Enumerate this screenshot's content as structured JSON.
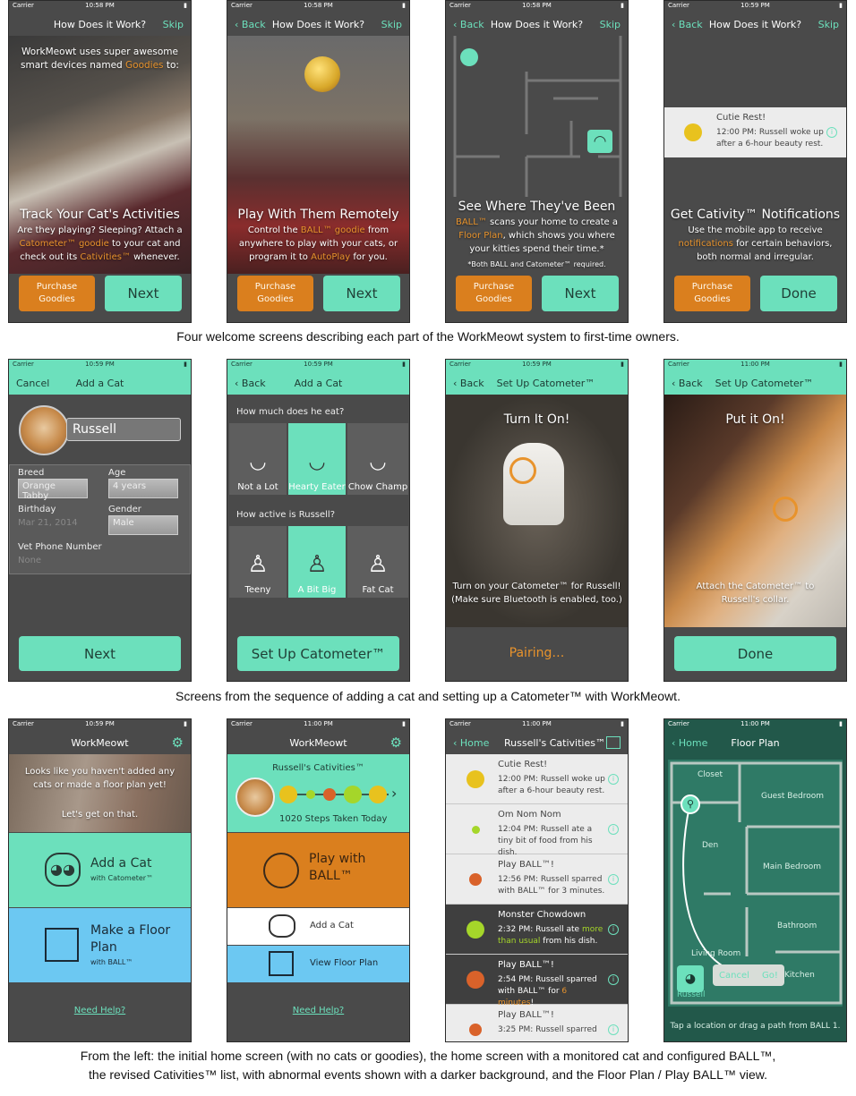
{
  "common": {
    "carrier": "Carrier",
    "skip": "Skip",
    "back": "Back",
    "next": "Next",
    "done": "Done",
    "cancel": "Cancel",
    "purchase_goodies": "Purchase Goodies"
  },
  "row1": {
    "screens": [
      {
        "time": "10:58 PM",
        "title": "How Does it Work?",
        "intro_a": "WorkMeowt uses super awesome smart devices named ",
        "intro_b": "Goodies",
        "intro_c": " to:",
        "heading": "Track Your Cat's Activities",
        "body_a": "Are they playing? Sleeping? Attach a ",
        "body_b": "Catometer™ goodie",
        "body_c": " to your cat and check out its ",
        "body_d": "Cativities™",
        "body_e": " whenever."
      },
      {
        "time": "10:58 PM",
        "title": "How Does it Work?",
        "heading": "Play With Them Remotely",
        "body_a": "Control the ",
        "body_b": "BALL™ goodie",
        "body_c": " from anywhere to play with your cats, or program it to ",
        "body_d": "AutoPlay",
        "body_e": " for you."
      },
      {
        "time": "10:58 PM",
        "title": "How Does it Work?",
        "heading": "See Where They've Been",
        "body_a": "BALL™",
        "body_b": " scans your home to create a ",
        "body_c": "Floor Plan",
        "body_d": ", which shows you where your kitties spend their time.*",
        "note": "*Both BALL and Catometer™ required."
      },
      {
        "time": "10:59 PM",
        "title": "How Does it Work?",
        "notif_title": "Cutie Rest!",
        "notif_body": "12:00 PM: Russell woke up after a 6-hour beauty rest.",
        "heading": "Get Cativity™ Notifications",
        "body_a": "Use the mobile app to receive ",
        "body_b": "notifications",
        "body_c": " for certain behaviors, both normal and irregular."
      }
    ],
    "caption": "Four welcome screens describing each part of the WorkMeowt system to first-time owners."
  },
  "row2": {
    "add_cat": {
      "time": "10:59 PM",
      "title": "Add a Cat",
      "name": "Russell",
      "breed_label": "Breed",
      "breed": "Orange Tabby",
      "age_label": "Age",
      "age": "4 years",
      "birthday_label": "Birthday",
      "birthday": "Mar 21, 2014",
      "gender_label": "Gender",
      "gender": "Male",
      "vet_label": "Vet Phone Number",
      "vet": "None"
    },
    "habits": {
      "time": "10:59 PM",
      "title": "Add a Cat",
      "q1": "How much does he eat?",
      "eat": [
        "Not a Lot",
        "Hearty Eater",
        "Chow Champ"
      ],
      "q2": "How active is Russell?",
      "size": [
        "Teeny",
        "A Bit Big",
        "Fat Cat"
      ],
      "button": "Set Up Catometer™"
    },
    "turn_on": {
      "time": "10:59 PM",
      "title": "Set Up Catometer™",
      "heading": "Turn It On!",
      "body": "Turn on your Catometer™ for Russell! (Make sure Bluetooth is enabled, too.)",
      "status": "Pairing…"
    },
    "put_on": {
      "time": "11:00 PM",
      "title": "Set Up Catometer™",
      "heading": "Put it On!",
      "body": "Attach the Catometer™ to Russell's collar."
    },
    "caption": "Screens from the sequence of adding a cat and setting up a Catometer™ with WorkMeowt."
  },
  "row3": {
    "home_empty": {
      "time": "10:59 PM",
      "title": "WorkMeowt",
      "banner": "Looks like you haven't added any cats or made a floor plan yet!",
      "banner2": "Let's get on that.",
      "add_title": "Add a Cat",
      "add_sub": "with Catometer™",
      "plan_title": "Make a Floor Plan",
      "plan_sub": "with BALL™",
      "help": "Need Help?"
    },
    "home_full": {
      "time": "11:00 PM",
      "title": "WorkMeowt",
      "cativities": "Russell's Cativities™",
      "steps": "1020 Steps Taken Today",
      "play": "Play with BALL™",
      "add_cat": "Add a Cat",
      "floor": "View Floor Plan",
      "help": "Need Help?"
    },
    "list": {
      "time": "11:00 PM",
      "back": "Home",
      "title": "Russell's Cativities™",
      "events": [
        {
          "title": "Cutie Rest!",
          "body": "12:00 PM: Russell woke up after a 6-hour beauty rest.",
          "color": "#e8c21e",
          "dark": false
        },
        {
          "title": "Om Nom Nom",
          "body": "12:04 PM: Russell ate a tiny bit of food from his dish.",
          "color": "#a5d62a",
          "dark": false
        },
        {
          "title": "Play BALL™!",
          "body": "12:56 PM: Russell sparred with BALL™ for 3 minutes.",
          "color": "#d9622a",
          "dark": false
        },
        {
          "title": "Monster Chowdown",
          "body_a": "2:32 PM: Russell ate ",
          "body_b": "more than usual",
          "body_c": " from his dish.",
          "color": "#a5d62a",
          "dark": true
        },
        {
          "title": "Play BALL™!",
          "body_a": "2:54 PM: Russell sparred with BALL™ for ",
          "body_b": "6 minutes",
          "body_c": "!",
          "color": "#d9622a",
          "dark": true
        },
        {
          "title": "Play BALL™!",
          "body": "3:25 PM: Russell sparred",
          "color": "#d9622a",
          "dark": false
        }
      ]
    },
    "floor_plan": {
      "time": "11:00 PM",
      "back": "Home",
      "title": "Floor Plan",
      "rooms": [
        "Closet",
        "Guest Bedroom",
        "Den",
        "Main Bedroom",
        "Bathroom",
        "Living Room",
        "Kitchen"
      ],
      "cat": "Russell",
      "cancel": "Cancel",
      "go": "Go!",
      "hint": "Tap a location or drag a path from BALL 1."
    },
    "caption1": "From the left: the initial home screen (with no cats or goodies), the home screen with a monitored cat and configured BALL™,",
    "caption2": "the revised Cativities™ list, with abnormal events shown with a darker background, and the Floor Plan / Play BALL™ view."
  },
  "colors": {
    "mint": "#6ce0bc",
    "orange": "#da7f1e",
    "blue": "#6cc8f2",
    "dark_gray": "#4a4a4a",
    "floor_green": "#22584a"
  }
}
